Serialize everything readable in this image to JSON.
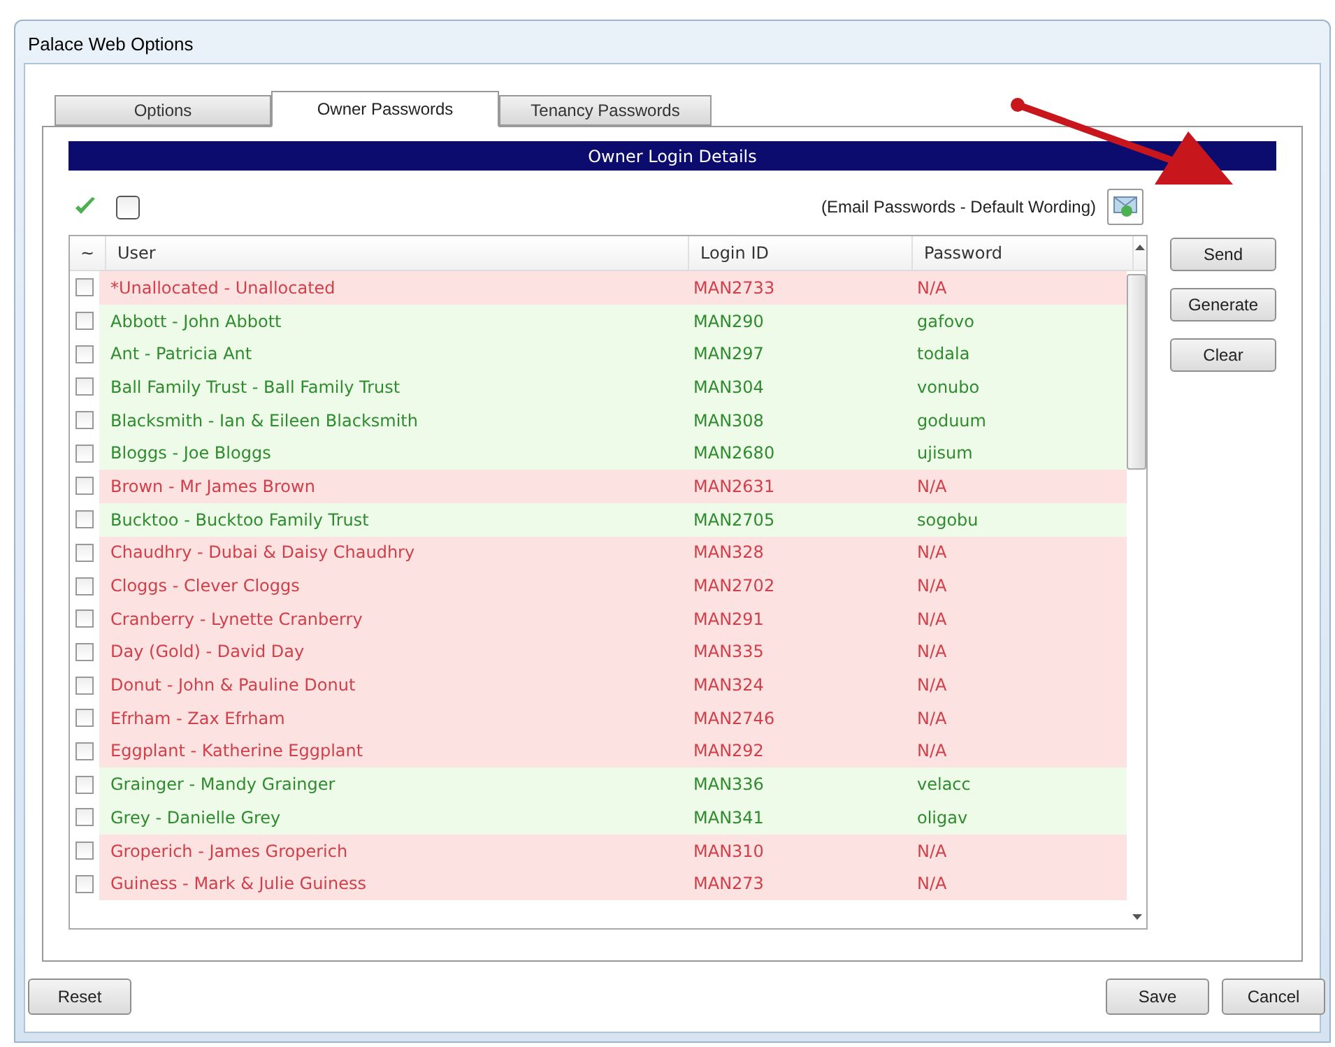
{
  "window": {
    "title": "Palace Web Options"
  },
  "tabs": [
    {
      "label": "Options",
      "selected": false
    },
    {
      "label": "Owner Passwords",
      "selected": true
    },
    {
      "label": "Tenancy Passwords",
      "selected": false
    }
  ],
  "section_header": "Owner Login Details",
  "toolbar": {
    "select_all_checked": false,
    "email_label": "(Email Passwords - Default Wording)"
  },
  "table": {
    "columns": [
      "~",
      "User",
      "Login ID",
      "Password"
    ],
    "rows": [
      {
        "user": "*Unallocated - Unallocated",
        "login_id": "MAN2733",
        "password": "N/A",
        "kind": "missing",
        "checked": false
      },
      {
        "user": "Abbott - John Abbott",
        "login_id": "MAN290",
        "password": "gafovo",
        "kind": "set",
        "checked": false
      },
      {
        "user": "Ant - Patricia Ant",
        "login_id": "MAN297",
        "password": "todala",
        "kind": "set",
        "checked": false
      },
      {
        "user": "Ball Family Trust - Ball Family Trust",
        "login_id": "MAN304",
        "password": "vonubo",
        "kind": "set",
        "checked": false
      },
      {
        "user": "Blacksmith - Ian & Eileen Blacksmith",
        "login_id": "MAN308",
        "password": "goduum",
        "kind": "set",
        "checked": false
      },
      {
        "user": "Bloggs - Joe Bloggs",
        "login_id": "MAN2680",
        "password": "ujisum",
        "kind": "set",
        "checked": false
      },
      {
        "user": "Brown - Mr James Brown",
        "login_id": "MAN2631",
        "password": "N/A",
        "kind": "missing",
        "checked": false
      },
      {
        "user": "Bucktoo - Bucktoo Family Trust",
        "login_id": "MAN2705",
        "password": "sogobu",
        "kind": "set",
        "checked": false
      },
      {
        "user": "Chaudhry - Dubai & Daisy Chaudhry",
        "login_id": "MAN328",
        "password": "N/A",
        "kind": "missing",
        "checked": false
      },
      {
        "user": "Cloggs - Clever Cloggs",
        "login_id": "MAN2702",
        "password": "N/A",
        "kind": "missing",
        "checked": false
      },
      {
        "user": "Cranberry - Lynette Cranberry",
        "login_id": "MAN291",
        "password": "N/A",
        "kind": "missing",
        "checked": false
      },
      {
        "user": "Day (Gold) - David Day",
        "login_id": "MAN335",
        "password": "N/A",
        "kind": "missing",
        "checked": false
      },
      {
        "user": "Donut - John & Pauline Donut",
        "login_id": "MAN324",
        "password": "N/A",
        "kind": "missing",
        "checked": false
      },
      {
        "user": "Efrham - Zax Efrham",
        "login_id": "MAN2746",
        "password": "N/A",
        "kind": "missing",
        "checked": false
      },
      {
        "user": "Eggplant - Katherine Eggplant",
        "login_id": "MAN292",
        "password": "N/A",
        "kind": "missing",
        "checked": false
      },
      {
        "user": "Grainger - Mandy Grainger",
        "login_id": "MAN336",
        "password": "velacc",
        "kind": "set",
        "checked": false
      },
      {
        "user": "Grey - Danielle Grey",
        "login_id": "MAN341",
        "password": "oligav",
        "kind": "set",
        "checked": false
      },
      {
        "user": "Groperich - James Groperich",
        "login_id": "MAN310",
        "password": "N/A",
        "kind": "missing",
        "checked": false
      },
      {
        "user": "Guiness - Mark & Julie Guiness",
        "login_id": "MAN273",
        "password": "N/A",
        "kind": "missing",
        "checked": false
      }
    ]
  },
  "side_buttons": [
    "Send",
    "Generate",
    "Clear"
  ],
  "footer": {
    "left_buttons": [
      "Reset"
    ],
    "right_buttons": [
      "Save",
      "Cancel"
    ]
  }
}
